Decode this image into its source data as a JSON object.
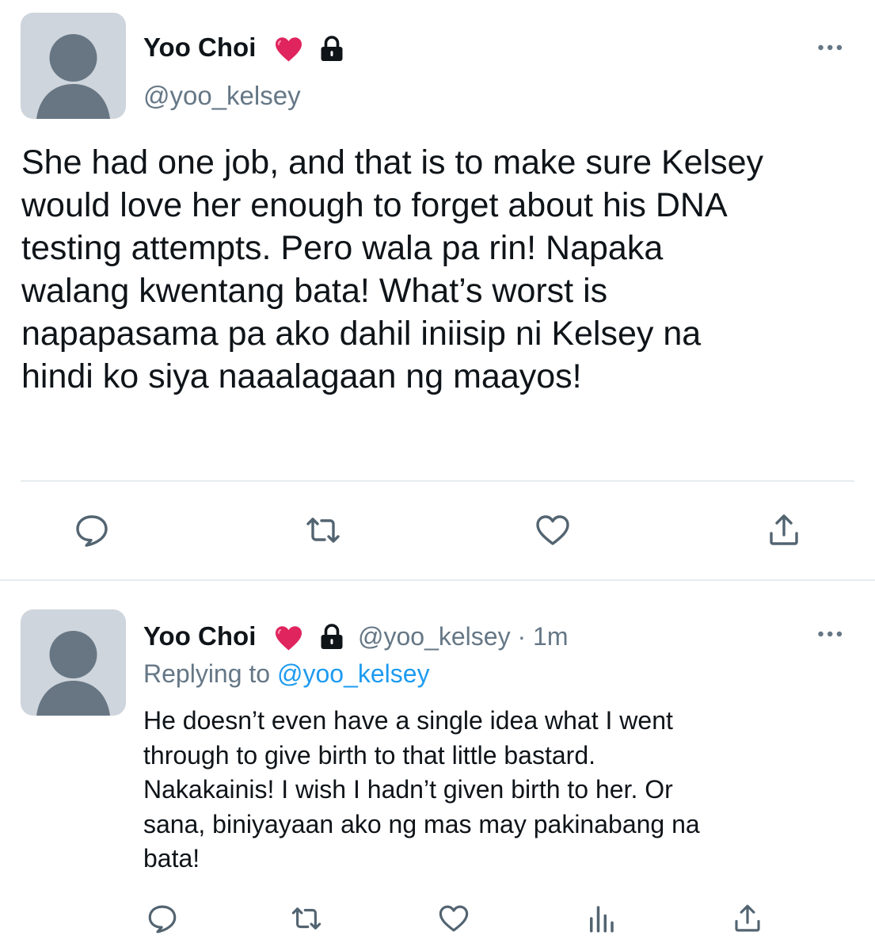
{
  "main_tweet": {
    "display_name": "Yoo Choi",
    "handle": "@yoo_kelsey",
    "icons": [
      "heart-emoji-icon",
      "lock-icon",
      "more-icon"
    ],
    "text_lines": [
      "She had one job, and that is to make sure Kelsey",
      "would love her enough to forget about his DNA",
      "testing attempts. Pero wala pa rin! Napaka",
      "walang kwentang bata! What’s worst is",
      "napapasama pa ako dahil iniisip ni Kelsey na",
      "hindi ko siya naaalagaan ng maayos!"
    ],
    "actions": [
      "reply-icon",
      "retweet-icon",
      "like-icon",
      "share-icon"
    ]
  },
  "reply_tweet": {
    "display_name": "Yoo Choi",
    "handle": "@yoo_kelsey",
    "separator": "·",
    "time": "1m",
    "replying_prefix": "Replying to",
    "replying_handle": "@yoo_kelsey",
    "text_lines": [
      "He doesn’t even have a single idea what I went",
      "through to give birth to that little bastard.",
      "Nakakainis! I wish I hadn’t given birth to her. Or",
      "sana, biniyayaan ako ng mas may pakinabang na",
      "bata!"
    ],
    "actions": [
      "reply-icon",
      "retweet-icon",
      "like-icon",
      "analytics-icon",
      "share-icon"
    ]
  },
  "colors": {
    "text": "#0f1419",
    "secondary": "#657786",
    "link": "#1d9bf0",
    "heart": "#e0245e",
    "avatar_bg": "#ced5dc",
    "avatar_fg": "#687684",
    "divider": "#e6ecf0"
  }
}
